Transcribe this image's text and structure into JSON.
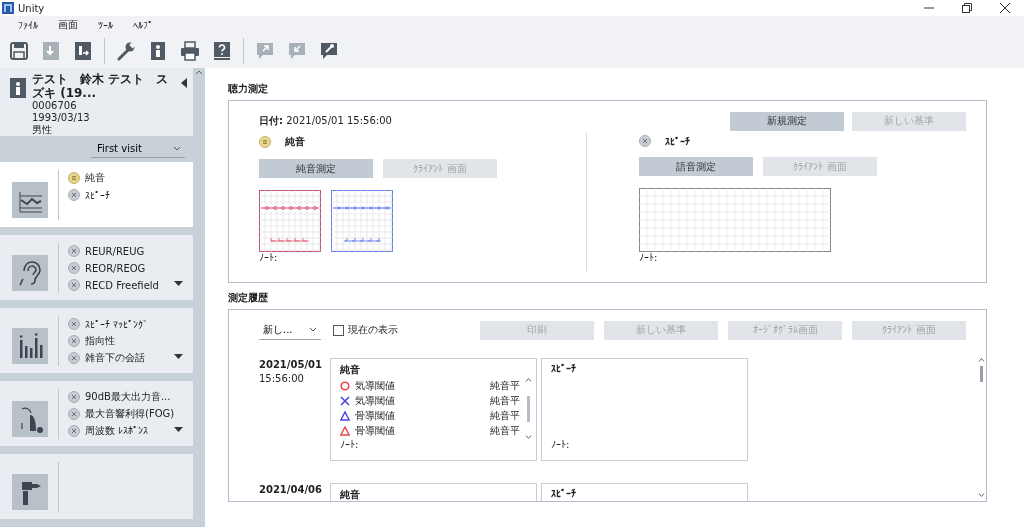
{
  "window": {
    "title": "Unity"
  },
  "menu": [
    "ﾌｧｲﾙ",
    "画面",
    "ﾂｰﾙ",
    "ﾍﾙﾌﾟ"
  ],
  "toolbar_groups": [
    {
      "tools": [
        {
          "kind": "save",
          "disabled": false
        },
        {
          "kind": "doc-in",
          "disabled": true
        },
        {
          "kind": "doc-out",
          "disabled": false
        }
      ]
    },
    {
      "tools": [
        {
          "kind": "wrench",
          "disabled": false
        },
        {
          "kind": "person-doc",
          "disabled": false
        },
        {
          "kind": "printer",
          "disabled": false
        },
        {
          "kind": "help",
          "disabled": false
        }
      ]
    },
    {
      "tools": [
        {
          "kind": "bubble-out",
          "disabled": true
        },
        {
          "kind": "bubble-in",
          "disabled": true
        },
        {
          "kind": "bubble-tool",
          "disabled": false
        }
      ]
    }
  ],
  "patient": {
    "name": "テスト　鈴木 テスト　スズキ (19...",
    "id": "0006706",
    "birthdate": "1993/03/13",
    "sex": "男性"
  },
  "visit": {
    "value": "First visit"
  },
  "sections": [
    {
      "kind": "chart",
      "selected": true,
      "more": false,
      "items": [
        {
          "label": "純音",
          "measured": true
        },
        {
          "label": "ｽﾋﾟｰﾁ",
          "measured": false
        }
      ]
    },
    {
      "kind": "ear",
      "selected": false,
      "more": true,
      "items": [
        {
          "label": "REUR/REUG",
          "measured": false
        },
        {
          "label": "REOR/REOG",
          "measured": false
        },
        {
          "label": "RECD Freefield",
          "measured": false
        }
      ]
    },
    {
      "kind": "bars",
      "selected": false,
      "more": true,
      "items": [
        {
          "label": "ｽﾋﾟｰﾁ ﾏｯﾋﾟﾝｸﾞ",
          "measured": false
        },
        {
          "label": "指向性",
          "measured": false
        },
        {
          "label": "雑音下の会話",
          "measured": false
        }
      ]
    },
    {
      "kind": "hearing-aid",
      "selected": false,
      "more": true,
      "items": [
        {
          "label": "90dB最大出力音...",
          "measured": false
        },
        {
          "label": "最大音響利得(FOG)",
          "measured": false
        },
        {
          "label": "周波数 ﾚｽﾎﾟﾝｽ",
          "measured": false
        }
      ]
    },
    {
      "kind": "probe",
      "selected": false,
      "more": false
    }
  ],
  "audiometry": {
    "title": "聴力測定",
    "date_label": "日付:",
    "date": "2021/05/01 15:56:00",
    "buttons": [
      {
        "label": "新規測定",
        "disabled": false
      },
      {
        "label": "新しい基準",
        "disabled": true
      }
    ],
    "panels": [
      {
        "kind": "pure-tone",
        "label": "純音",
        "measured": true,
        "buttons": [
          {
            "label": "純音測定",
            "disabled": false
          },
          {
            "label": "ｸﾗｲｱﾝﾄ 画面",
            "disabled": true
          }
        ],
        "note": "ﾉｰﾄ:"
      },
      {
        "kind": "speech",
        "label": "ｽﾋﾟｰﾁ",
        "measured": false,
        "buttons": [
          {
            "label": "語音測定",
            "disabled": false
          },
          {
            "label": "ｸﾗｲｱﾝﾄ 画面",
            "disabled": true
          }
        ],
        "note": "ﾉｰﾄ:"
      }
    ]
  },
  "history": {
    "title": "測定履歴",
    "sort": "新し...",
    "current_view": {
      "label": "現在の表示",
      "checked": false
    },
    "buttons": [
      {
        "label": "印刷",
        "disabled": true
      },
      {
        "label": "新しい基準",
        "disabled": true
      },
      {
        "label": "ｵｰｼﾞｵｸﾞﾗﾑ画面",
        "disabled": true
      },
      {
        "label": "ｸﾗｲｱﾝﾄ 画面",
        "disabled": true
      }
    ],
    "entries": [
      {
        "date": "2021/05/01",
        "time": "15:56:00",
        "cards": [
          {
            "title": "純音",
            "rows": [
              {
                "kind": "circle",
                "color": "#e84848",
                "label": "気導閾値",
                "value": "純音平"
              },
              {
                "kind": "cross",
                "color": "#4848e0",
                "label": "気導閾値",
                "value": "純音平"
              },
              {
                "kind": "triangle",
                "color": "#4848e0",
                "label": "骨導閾値",
                "value": "純音平"
              },
              {
                "kind": "triangle",
                "color": "#e84848",
                "label": "骨導閾値",
                "value": "純音平"
              }
            ],
            "note": "ﾉｰﾄ:"
          },
          {
            "title": "ｽﾋﾟｰﾁ",
            "note": "ﾉｰﾄ:"
          }
        ]
      },
      {
        "date": "2021/04/06",
        "cards": [
          {
            "title": "純音"
          },
          {
            "title": "ｽﾋﾟｰﾁ"
          }
        ]
      }
    ]
  }
}
